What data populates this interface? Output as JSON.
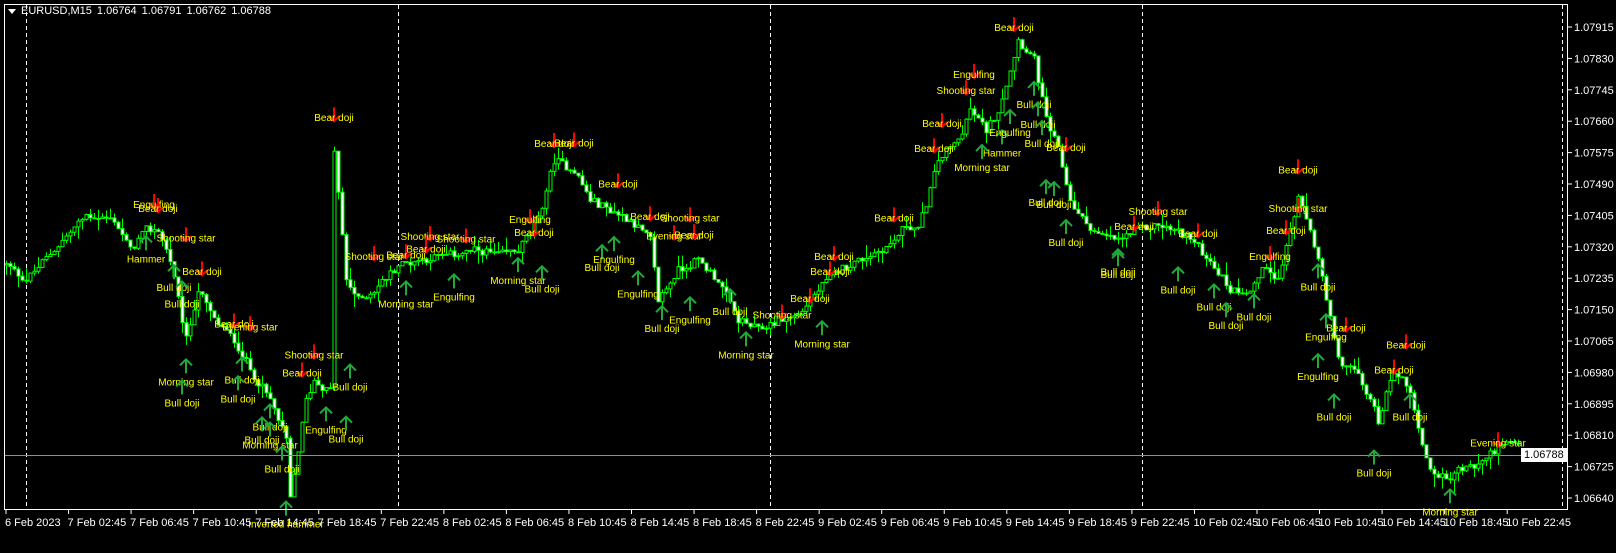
{
  "header": {
    "symbol": "EURUSD,M15",
    "open": "1.06764",
    "high": "1.06791",
    "low": "1.06762",
    "close": "1.06788"
  },
  "current_price": "1.06788",
  "colors": {
    "background": "#000000",
    "candle": "#00ff00",
    "bear_body": "#ffffff",
    "bull_body": "#000000",
    "axis": "#ffffff",
    "bear_arrow": "#ff0000",
    "bull_arrow": "#1faa3a",
    "label": "#ffff00",
    "price_line": "#8a8f99"
  },
  "chart_data": {
    "type": "candlestick",
    "title": "EURUSD,M15",
    "ylim": [
      1.0664,
      1.07915
    ],
    "y_ticks": [
      "1.07915",
      "1.07830",
      "1.07745",
      "1.07660",
      "1.07575",
      "1.07490",
      "1.07405",
      "1.07320",
      "1.07235",
      "1.07150",
      "1.07065",
      "1.06980",
      "1.06895",
      "1.06810",
      "1.06725",
      "1.06640"
    ],
    "x_ticks": [
      "6 Feb 2023",
      "7 Feb 02:45",
      "7 Feb 06:45",
      "7 Feb 10:45",
      "7 Feb 14:45",
      "7 Feb 18:45",
      "7 Feb 22:45",
      "8 Feb 02:45",
      "8 Feb 06:45",
      "8 Feb 10:45",
      "8 Feb 14:45",
      "8 Feb 18:45",
      "8 Feb 22:45",
      "9 Feb 02:45",
      "9 Feb 06:45",
      "9 Feb 10:45",
      "9 Feb 14:45",
      "9 Feb 18:45",
      "9 Feb 22:45",
      "10 Feb 02:45",
      "10 Feb 06:45",
      "10 Feb 10:45",
      "10 Feb 14:45",
      "10 Feb 18:45",
      "10 Feb 22:45"
    ],
    "day_separator_candles": [
      5,
      98,
      191,
      284
    ],
    "close_path": [
      [
        0,
        1.07271
      ],
      [
        5,
        1.0723
      ],
      [
        13,
        1.07325
      ],
      [
        20,
        1.07406
      ],
      [
        27,
        1.07393
      ],
      [
        31,
        1.07311
      ],
      [
        35,
        1.07366
      ],
      [
        38,
        1.07366
      ],
      [
        41,
        1.07284
      ],
      [
        43,
        1.07176
      ],
      [
        45,
        1.07068
      ],
      [
        48,
        1.07203
      ],
      [
        52,
        1.07122
      ],
      [
        57,
        1.07068
      ],
      [
        61,
        1.06987
      ],
      [
        66,
        1.06905
      ],
      [
        70,
        1.06797
      ],
      [
        71,
        1.06635
      ],
      [
        75,
        1.06905
      ],
      [
        77,
        1.06959
      ],
      [
        80,
        1.06932
      ],
      [
        81,
        1.06932
      ],
      [
        82,
        1.07582
      ],
      [
        85,
        1.0723
      ],
      [
        88,
        1.07176
      ],
      [
        92,
        1.07203
      ],
      [
        98,
        1.07271
      ],
      [
        103,
        1.07284
      ],
      [
        111,
        1.07298
      ],
      [
        118,
        1.07311
      ],
      [
        123,
        1.07298
      ],
      [
        128,
        1.07311
      ],
      [
        133,
        1.07393
      ],
      [
        137,
        1.07555
      ],
      [
        142,
        1.07528
      ],
      [
        146,
        1.07447
      ],
      [
        151,
        1.0742
      ],
      [
        156,
        1.07393
      ],
      [
        161,
        1.07338
      ],
      [
        163,
        1.07176
      ],
      [
        168,
        1.07257
      ],
      [
        173,
        1.07284
      ],
      [
        178,
        1.0723
      ],
      [
        183,
        1.07122
      ],
      [
        188,
        1.07095
      ],
      [
        193,
        1.07122
      ],
      [
        198,
        1.07135
      ],
      [
        203,
        1.07203
      ],
      [
        208,
        1.07257
      ],
      [
        216,
        1.07298
      ],
      [
        221,
        1.07325
      ],
      [
        225,
        1.07379
      ],
      [
        228,
        1.07366
      ],
      [
        231,
        1.07474
      ],
      [
        233,
        1.07555
      ],
      [
        238,
        1.07609
      ],
      [
        241,
        1.0769
      ],
      [
        245,
        1.07636
      ],
      [
        248,
        1.0769
      ],
      [
        251,
        1.07799
      ],
      [
        253,
        1.0788
      ],
      [
        257,
        1.07826
      ],
      [
        260,
        1.07663
      ],
      [
        263,
        1.07582
      ],
      [
        266,
        1.07447
      ],
      [
        268,
        1.07406
      ],
      [
        273,
        1.07352
      ],
      [
        278,
        1.07338
      ],
      [
        283,
        1.07366
      ],
      [
        288,
        1.07379
      ],
      [
        295,
        1.07352
      ],
      [
        301,
        1.07284
      ],
      [
        306,
        1.07203
      ],
      [
        311,
        1.07203
      ],
      [
        315,
        1.07271
      ],
      [
        318,
        1.0723
      ],
      [
        321,
        1.07366
      ],
      [
        323,
        1.07447
      ],
      [
        326,
        1.07366
      ],
      [
        328,
        1.07284
      ],
      [
        331,
        1.07122
      ],
      [
        333,
        1.07014
      ],
      [
        337,
        1.06987
      ],
      [
        341,
        1.06905
      ],
      [
        343,
        1.06851
      ],
      [
        347,
        1.06987
      ],
      [
        351,
        1.06932
      ],
      [
        353,
        1.06824
      ],
      [
        356,
        1.06716
      ],
      [
        360,
        1.06689
      ],
      [
        363,
        1.06716
      ],
      [
        368,
        1.06729
      ],
      [
        372,
        1.0677
      ],
      [
        376,
        1.06788
      ],
      [
        378,
        1.06788
      ]
    ],
    "patterns": [
      {
        "i": 37,
        "p": 1.07425,
        "t": "Engulfing",
        "k": "bear"
      },
      {
        "i": 38,
        "p": 1.07414,
        "t": "Bear doji",
        "k": "bear"
      },
      {
        "i": 45,
        "p": 1.07335,
        "t": "Shooting star",
        "k": "bear"
      },
      {
        "i": 49,
        "p": 1.07243,
        "t": "Bear doji",
        "k": "bear"
      },
      {
        "i": 57,
        "p": 1.07102,
        "t": "Bear doji",
        "k": "bear"
      },
      {
        "i": 61,
        "p": 1.07094,
        "t": "Evening star",
        "k": "bear"
      },
      {
        "i": 77,
        "p": 1.07018,
        "t": "Shooting star",
        "k": "bear"
      },
      {
        "i": 74,
        "p": 1.06969,
        "t": "Bear doji",
        "k": "bear"
      },
      {
        "i": 82,
        "p": 1.0766,
        "t": "Bear doji",
        "k": "bear"
      },
      {
        "i": 137,
        "p": 1.0759,
        "t": "Bear doji",
        "k": "bear"
      },
      {
        "i": 142,
        "p": 1.07592,
        "t": "Bear doji",
        "k": "bear"
      },
      {
        "i": 153,
        "p": 1.07481,
        "t": "Bear doji",
        "k": "bear"
      },
      {
        "i": 161,
        "p": 1.07392,
        "t": "Bear doji",
        "k": "bear"
      },
      {
        "i": 171,
        "p": 1.07389,
        "t": "Shooting star",
        "k": "bear"
      },
      {
        "i": 167,
        "p": 1.0734,
        "t": "Evening star",
        "k": "bear"
      },
      {
        "i": 172,
        "p": 1.07343,
        "t": "Bear doji",
        "k": "bear"
      },
      {
        "i": 132,
        "p": 1.07349,
        "t": "Bear doji",
        "k": "bear"
      },
      {
        "i": 131,
        "p": 1.07384,
        "t": "Engulfing",
        "k": "bear"
      },
      {
        "i": 106,
        "p": 1.07338,
        "t": "Shooting star",
        "k": "bear"
      },
      {
        "i": 115,
        "p": 1.07332,
        "t": "Shooting star",
        "k": "bear"
      },
      {
        "i": 105,
        "p": 1.07305,
        "t": "Bear doji",
        "k": "bear"
      },
      {
        "i": 92,
        "p": 1.07284,
        "t": "Shooting star",
        "k": "bear"
      },
      {
        "i": 100,
        "p": 1.07289,
        "t": "Bear doji",
        "k": "bear"
      },
      {
        "i": 222,
        "p": 1.07389,
        "t": "Bear doji",
        "k": "bear"
      },
      {
        "i": 252,
        "p": 1.07904,
        "t": "Bear doji",
        "k": "bear"
      },
      {
        "i": 242,
        "p": 1.07777,
        "t": "Engulfing",
        "k": "bear"
      },
      {
        "i": 240,
        "p": 1.07733,
        "t": "Shooting star",
        "k": "bear"
      },
      {
        "i": 234,
        "p": 1.07644,
        "t": "Bear doji",
        "k": "bear"
      },
      {
        "i": 232,
        "p": 1.07576,
        "t": "Bear doji",
        "k": "bear"
      },
      {
        "i": 265,
        "p": 1.07579,
        "t": "Bear doji",
        "k": "bear"
      },
      {
        "i": 288,
        "p": 1.07406,
        "t": "Shooting star",
        "k": "bear"
      },
      {
        "i": 282,
        "p": 1.07365,
        "t": "Bear doji",
        "k": "bear"
      },
      {
        "i": 298,
        "p": 1.07346,
        "t": "Bear doji",
        "k": "bear"
      },
      {
        "i": 323,
        "p": 1.07519,
        "t": "Bear doji",
        "k": "bear"
      },
      {
        "i": 323,
        "p": 1.07414,
        "t": "Shooting star",
        "k": "bear"
      },
      {
        "i": 320,
        "p": 1.07354,
        "t": "Bear doji",
        "k": "bear"
      },
      {
        "i": 335,
        "p": 1.07091,
        "t": "Bear doji",
        "k": "bear"
      },
      {
        "i": 350,
        "p": 1.07045,
        "t": "Bear doji",
        "k": "bear"
      },
      {
        "i": 347,
        "p": 1.06977,
        "t": "Bear doji",
        "k": "bear"
      },
      {
        "i": 373,
        "p": 1.0678,
        "t": "Evening star",
        "k": "bear"
      },
      {
        "i": 207,
        "p": 1.07284,
        "t": "Bear doji",
        "k": "bear"
      },
      {
        "i": 206,
        "p": 1.07243,
        "t": "Bear doji",
        "k": "bear"
      },
      {
        "i": 201,
        "p": 1.0717,
        "t": "Bear doji",
        "k": "bear"
      },
      {
        "i": 194,
        "p": 1.07126,
        "t": "Shooting star",
        "k": "bear"
      },
      {
        "i": 316,
        "p": 1.07284,
        "t": "Engulfing",
        "k": "bear"
      },
      {
        "i": 35,
        "p": 1.07305,
        "t": "Hammer",
        "k": "bull"
      },
      {
        "i": 42,
        "p": 1.07227,
        "t": "Bull doji",
        "k": "bull"
      },
      {
        "i": 44,
        "p": 1.07183,
        "t": "Bull doji",
        "k": "bull"
      },
      {
        "i": 45,
        "p": 1.06972,
        "t": "Morning star",
        "k": "bull"
      },
      {
        "i": 44,
        "p": 1.06915,
        "t": "Bull doji",
        "k": "bull"
      },
      {
        "i": 59,
        "p": 1.06977,
        "t": "Bull doji",
        "k": "bull"
      },
      {
        "i": 58,
        "p": 1.06926,
        "t": "Bull doji",
        "k": "bull"
      },
      {
        "i": 66,
        "p": 1.0685,
        "t": "Bull doji",
        "k": "bull"
      },
      {
        "i": 64,
        "p": 1.06815,
        "t": "Bull doji",
        "k": "bull"
      },
      {
        "i": 66,
        "p": 1.06801,
        "t": "Morning star",
        "k": "bull"
      },
      {
        "i": 69,
        "p": 1.06736,
        "t": "Bull doji",
        "k": "bull"
      },
      {
        "i": 70,
        "p": 1.06587,
        "t": "Inverted hammer",
        "k": "bull"
      },
      {
        "i": 80,
        "p": 1.06842,
        "t": "Engulfing",
        "k": "bull"
      },
      {
        "i": 85,
        "p": 1.06817,
        "t": "Bull doji",
        "k": "bull"
      },
      {
        "i": 86,
        "p": 1.06958,
        "t": "Bull doji",
        "k": "bull"
      },
      {
        "i": 100,
        "p": 1.07183,
        "t": "Morning star",
        "k": "bull"
      },
      {
        "i": 112,
        "p": 1.07202,
        "t": "Engulfing",
        "k": "bull"
      },
      {
        "i": 128,
        "p": 1.07246,
        "t": "Morning star",
        "k": "bull"
      },
      {
        "i": 134,
        "p": 1.07224,
        "t": "Bull doji",
        "k": "bull"
      },
      {
        "i": 149,
        "p": 1.07281,
        "t": "Bull doji",
        "k": "bull"
      },
      {
        "i": 152,
        "p": 1.07303,
        "t": "Engulfing",
        "k": "bull"
      },
      {
        "i": 158,
        "p": 1.0721,
        "t": "Engulfing",
        "k": "bull"
      },
      {
        "i": 164,
        "p": 1.07116,
        "t": "Bull doji",
        "k": "bull"
      },
      {
        "i": 171,
        "p": 1.0714,
        "t": "Engulfing",
        "k": "bull"
      },
      {
        "i": 181,
        "p": 1.07162,
        "t": "Bull doji",
        "k": "bull"
      },
      {
        "i": 185,
        "p": 1.07045,
        "t": "Morning star",
        "k": "bull"
      },
      {
        "i": 204,
        "p": 1.07075,
        "t": "Morning star",
        "k": "bull"
      },
      {
        "i": 244,
        "p": 1.07552,
        "t": "Morning star",
        "k": "bull"
      },
      {
        "i": 249,
        "p": 1.07592,
        "t": "Hammer",
        "k": "bull"
      },
      {
        "i": 251,
        "p": 1.07647,
        "t": "Engulfing",
        "k": "bull"
      },
      {
        "i": 257,
        "p": 1.07723,
        "t": "Bull doji",
        "k": "bull"
      },
      {
        "i": 258,
        "p": 1.07668,
        "t": "Bull doji",
        "k": "bull"
      },
      {
        "i": 259,
        "p": 1.07617,
        "t": "Bull doji",
        "k": "bull"
      },
      {
        "i": 260,
        "p": 1.07457,
        "t": "Bull doji",
        "k": "bull"
      },
      {
        "i": 262,
        "p": 1.07452,
        "t": "Bull doji",
        "k": "bull"
      },
      {
        "i": 265,
        "p": 1.07349,
        "t": "Bull doji",
        "k": "bull"
      },
      {
        "i": 278,
        "p": 1.0727,
        "t": "Bull doji",
        "k": "bull"
      },
      {
        "i": 278,
        "p": 1.07262,
        "t": "Bull doji",
        "k": "bull"
      },
      {
        "i": 293,
        "p": 1.07221,
        "t": "Bull doji",
        "k": "bull"
      },
      {
        "i": 302,
        "p": 1.07175,
        "t": "Bull doji",
        "k": "bull"
      },
      {
        "i": 305,
        "p": 1.07124,
        "t": "Bull doji",
        "k": "bull"
      },
      {
        "i": 328,
        "p": 1.07229,
        "t": "Bull doji",
        "k": "bull"
      },
      {
        "i": 330,
        "p": 1.07094,
        "t": "Engulfing",
        "k": "bull"
      },
      {
        "i": 332,
        "p": 1.06877,
        "t": "Bull doji",
        "k": "bull"
      },
      {
        "i": 328,
        "p": 1.06986,
        "t": "Engulfing",
        "k": "bull"
      },
      {
        "i": 351,
        "p": 1.06877,
        "t": "Bull doji",
        "k": "bull"
      },
      {
        "i": 342,
        "p": 1.06725,
        "t": "Bull doji",
        "k": "bull"
      },
      {
        "i": 312,
        "p": 1.07148,
        "t": "Bull doji",
        "k": "bull"
      },
      {
        "i": 361,
        "p": 1.0662,
        "t": "Morning star",
        "k": "bull"
      }
    ]
  }
}
